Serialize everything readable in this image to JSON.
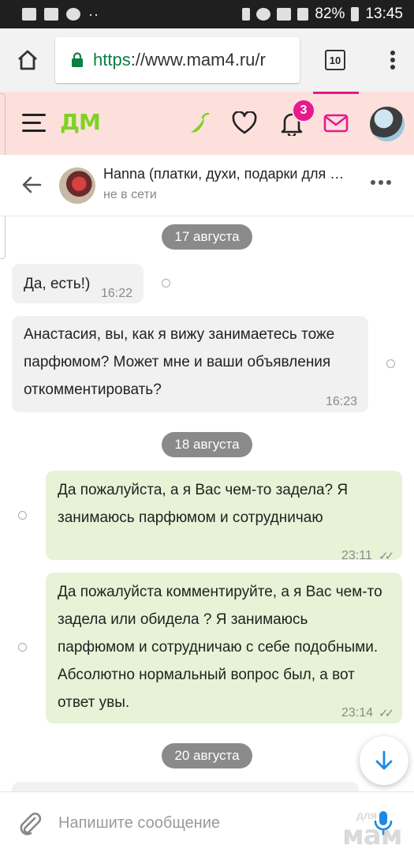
{
  "status_bar": {
    "battery": "82%",
    "time": "13:45"
  },
  "browser": {
    "url_scheme": "https",
    "url_rest": "://www.mam4.ru/r",
    "tab_count": "10"
  },
  "site_header": {
    "logo": "ДМ",
    "notifications_count": "3",
    "accent_color": "#e61a8d",
    "logo_color": "#7ed321"
  },
  "chat_header": {
    "peer_name": "Hanna (платки, духи, подарки для с...",
    "peer_status": "не в сети"
  },
  "messages": [
    {
      "type": "date",
      "text": "17 августа"
    },
    {
      "type": "incoming",
      "text": "Да, есть!)",
      "time": "16:22"
    },
    {
      "type": "incoming",
      "text": "Анастасия, вы, как я вижу занимаетесь тоже парфюмом? Может мне и ваши объявления откомментировать?",
      "time": "16:23"
    },
    {
      "type": "date",
      "text": "18 августа"
    },
    {
      "type": "outgoing",
      "text": "Да пожалуйста,  а я Вас чем-то задела? Я занимаюсь парфюмом и сотрудничаю",
      "time": "23:11",
      "ticks": "✓✓"
    },
    {
      "type": "outgoing",
      "text": "Да пожалуйста комментируйте,  а я Вас чем-то задела или обидела ? Я занимаюсь парфюмом и сотрудничаю с себе подобными. Абсолютно нормальный вопрос был, а вот ответ увы.",
      "time": "23:14",
      "ticks": "✓✓"
    },
    {
      "type": "date",
      "text": "20 августа"
    }
  ],
  "composer": {
    "placeholder": "Напишите сообщение"
  },
  "watermark": {
    "top": "для",
    "main": "мам"
  }
}
